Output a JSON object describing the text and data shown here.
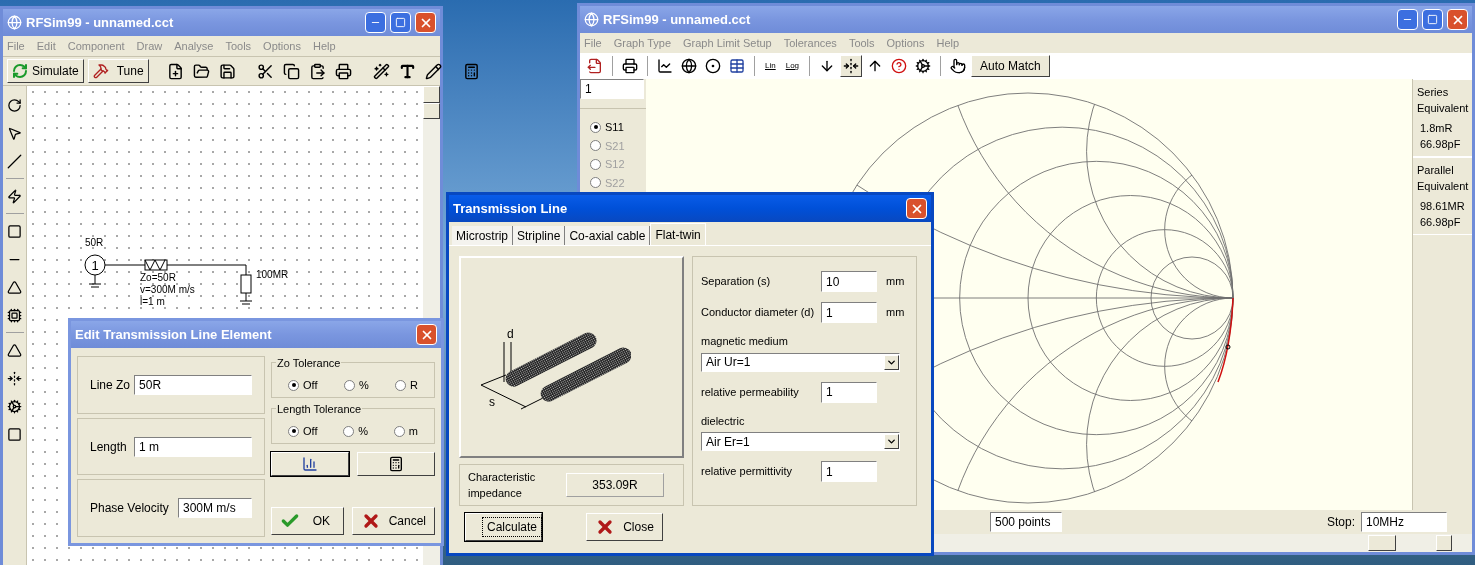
{
  "schematic_window": {
    "title": "RFSim99 - unnamed.cct",
    "active": false,
    "menu": [
      "File",
      "Edit",
      "Component",
      "Draw",
      "Analyse",
      "Tools",
      "Options",
      "Help"
    ],
    "toolbar_buttons": [
      "Simulate",
      "Tune"
    ],
    "circuit": {
      "source_label": "50R",
      "port": "1",
      "line_labels": [
        "Zo=50R",
        "v=300M m/s",
        "l=1 m"
      ],
      "load_label": "100MR"
    }
  },
  "edit_dialog": {
    "title": "Edit Transmission Line Element",
    "active": false,
    "fields": [
      {
        "label": "Line Zo",
        "value": "50R"
      },
      {
        "label": "Length",
        "value": "1 m"
      },
      {
        "label": "Phase Velocity",
        "value": "300M m/s"
      }
    ],
    "tolerance_groups": [
      {
        "title": "Zo Tolerance",
        "options": [
          {
            "label": "Off",
            "selected": true
          },
          {
            "label": "%",
            "selected": false
          },
          {
            "label": "R",
            "selected": false
          }
        ]
      },
      {
        "title": "Length Tolerance",
        "options": [
          {
            "label": "Off",
            "selected": true
          },
          {
            "label": "%",
            "selected": false
          },
          {
            "label": "m",
            "selected": false
          }
        ]
      }
    ],
    "buttons": [
      {
        "kind": "ok",
        "label": "OK",
        "focused": false
      },
      {
        "kind": "cancel",
        "label": "Cancel",
        "focused": false
      }
    ]
  },
  "graph_window": {
    "title": "RFSim99 - unnamed.cct",
    "active": false,
    "menu": [
      "File",
      "Graph Type",
      "Graph Limit Setup",
      "Tolerances",
      "Tools",
      "Options",
      "Help"
    ],
    "toolbar_labels": [
      "Lin",
      "Log"
    ],
    "auto_match": "Auto Match",
    "trace_field": "1",
    "parameters": [
      {
        "label": "S11",
        "selected": true,
        "disabled": false
      },
      {
        "label": "S21",
        "selected": false,
        "disabled": true
      },
      {
        "label": "S12",
        "selected": false,
        "disabled": true
      },
      {
        "label": "S22",
        "selected": false,
        "disabled": true
      }
    ],
    "equivalents": [
      {
        "title": "Series Equivalent",
        "values": [
          "1.8mR",
          "66.98pF"
        ]
      },
      {
        "title": "Parallel Equivalent",
        "values": [
          "98.61MR",
          "66.98pF"
        ]
      }
    ],
    "points_field": "500 points",
    "stop_label": "Stop:",
    "stop_value": "10MHz"
  },
  "line_dialog": {
    "title": "Transmission Line",
    "active": true,
    "tabs": [
      {
        "label": "Microstrip",
        "selected": false
      },
      {
        "label": "Stripline",
        "selected": false
      },
      {
        "label": "Co-axial cable",
        "selected": false
      },
      {
        "label": "Flat-twin",
        "selected": true
      }
    ],
    "diagram_labels": [
      "d",
      "s"
    ],
    "impedance_label": "Characteristic impedance",
    "impedance_value": "353.09R",
    "params": [
      {
        "kind": "field",
        "label": "Separation (s)",
        "value": "10",
        "unit": "mm"
      },
      {
        "kind": "field",
        "label": "Conductor diameter (d)",
        "value": "1",
        "unit": "mm"
      },
      {
        "kind": "select",
        "label": "magnetic medium",
        "value": "Air Ur=1"
      },
      {
        "kind": "field",
        "label": "relative permeability",
        "value": "1"
      },
      {
        "kind": "select",
        "label": "dielectric",
        "value": "Air Er=1"
      },
      {
        "kind": "field",
        "label": "relative permittivity",
        "value": "1"
      }
    ],
    "buttons": [
      {
        "kind": "ok",
        "label": "Calculate",
        "focused": true
      },
      {
        "kind": "cancel",
        "label": "Close",
        "focused": false
      }
    ]
  }
}
